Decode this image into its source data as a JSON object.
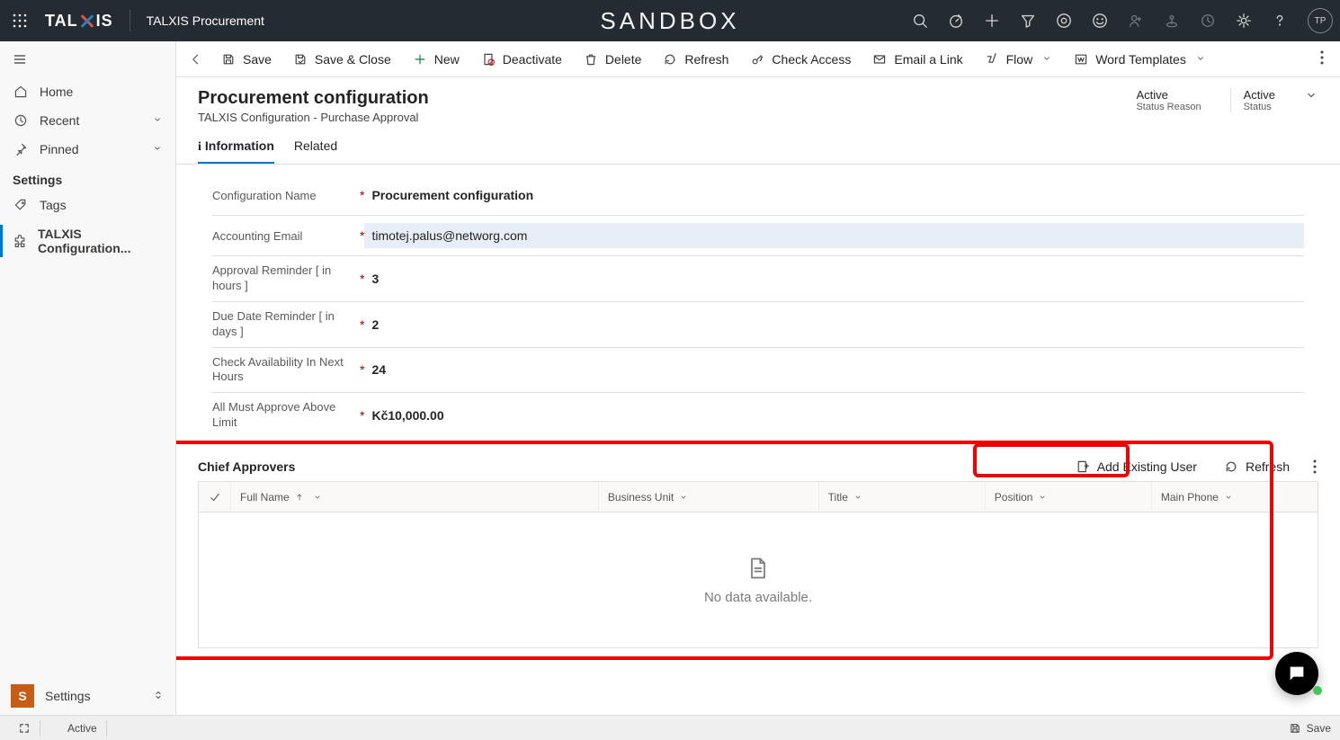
{
  "top": {
    "brand": "TALXIS",
    "app_name": "TALXIS Procurement",
    "env_label": "SANDBOX",
    "avatar": "TP"
  },
  "sidebar": {
    "home": "Home",
    "recent": "Recent",
    "pinned": "Pinned",
    "section": "Settings",
    "tags": "Tags",
    "config": "TALXIS Configuration...",
    "footer": "Settings",
    "footer_badge": "S"
  },
  "commands": {
    "save": "Save",
    "save_close": "Save & Close",
    "new": "New",
    "deactivate": "Deactivate",
    "delete": "Delete",
    "refresh": "Refresh",
    "check_access": "Check Access",
    "email_link": "Email a Link",
    "flow": "Flow",
    "word_templates": "Word Templates"
  },
  "header": {
    "title": "Procurement configuration",
    "subtitle": "TALXIS Configuration - Purchase Approval",
    "status1_value": "Active",
    "status1_label": "Status Reason",
    "status2_value": "Active",
    "status2_label": "Status"
  },
  "tabs": {
    "information": "Information",
    "related": "Related"
  },
  "fields": {
    "config_name_label": "Configuration Name",
    "config_name_value": "Procurement configuration",
    "accounting_email_label": "Accounting Email",
    "accounting_email_value": "timotej.palus@networg.com",
    "approval_reminder_label": "Approval Reminder [ in hours ]",
    "approval_reminder_value": "3",
    "due_date_reminder_label": "Due Date Reminder [ in days ]",
    "due_date_reminder_value": "2",
    "check_availability_label": "Check Availability In Next Hours",
    "check_availability_value": "24",
    "approve_limit_label": "All Must Approve Above Limit",
    "approve_limit_value": "Kč10,000.00"
  },
  "section": {
    "title": "Chief Approvers",
    "add_user": "Add Existing User",
    "refresh": "Refresh",
    "columns": {
      "full_name": "Full Name",
      "business_unit": "Business Unit",
      "title": "Title",
      "position": "Position",
      "main_phone": "Main Phone"
    },
    "empty": "No data available."
  },
  "statusbar": {
    "active": "Active",
    "save": "Save"
  }
}
